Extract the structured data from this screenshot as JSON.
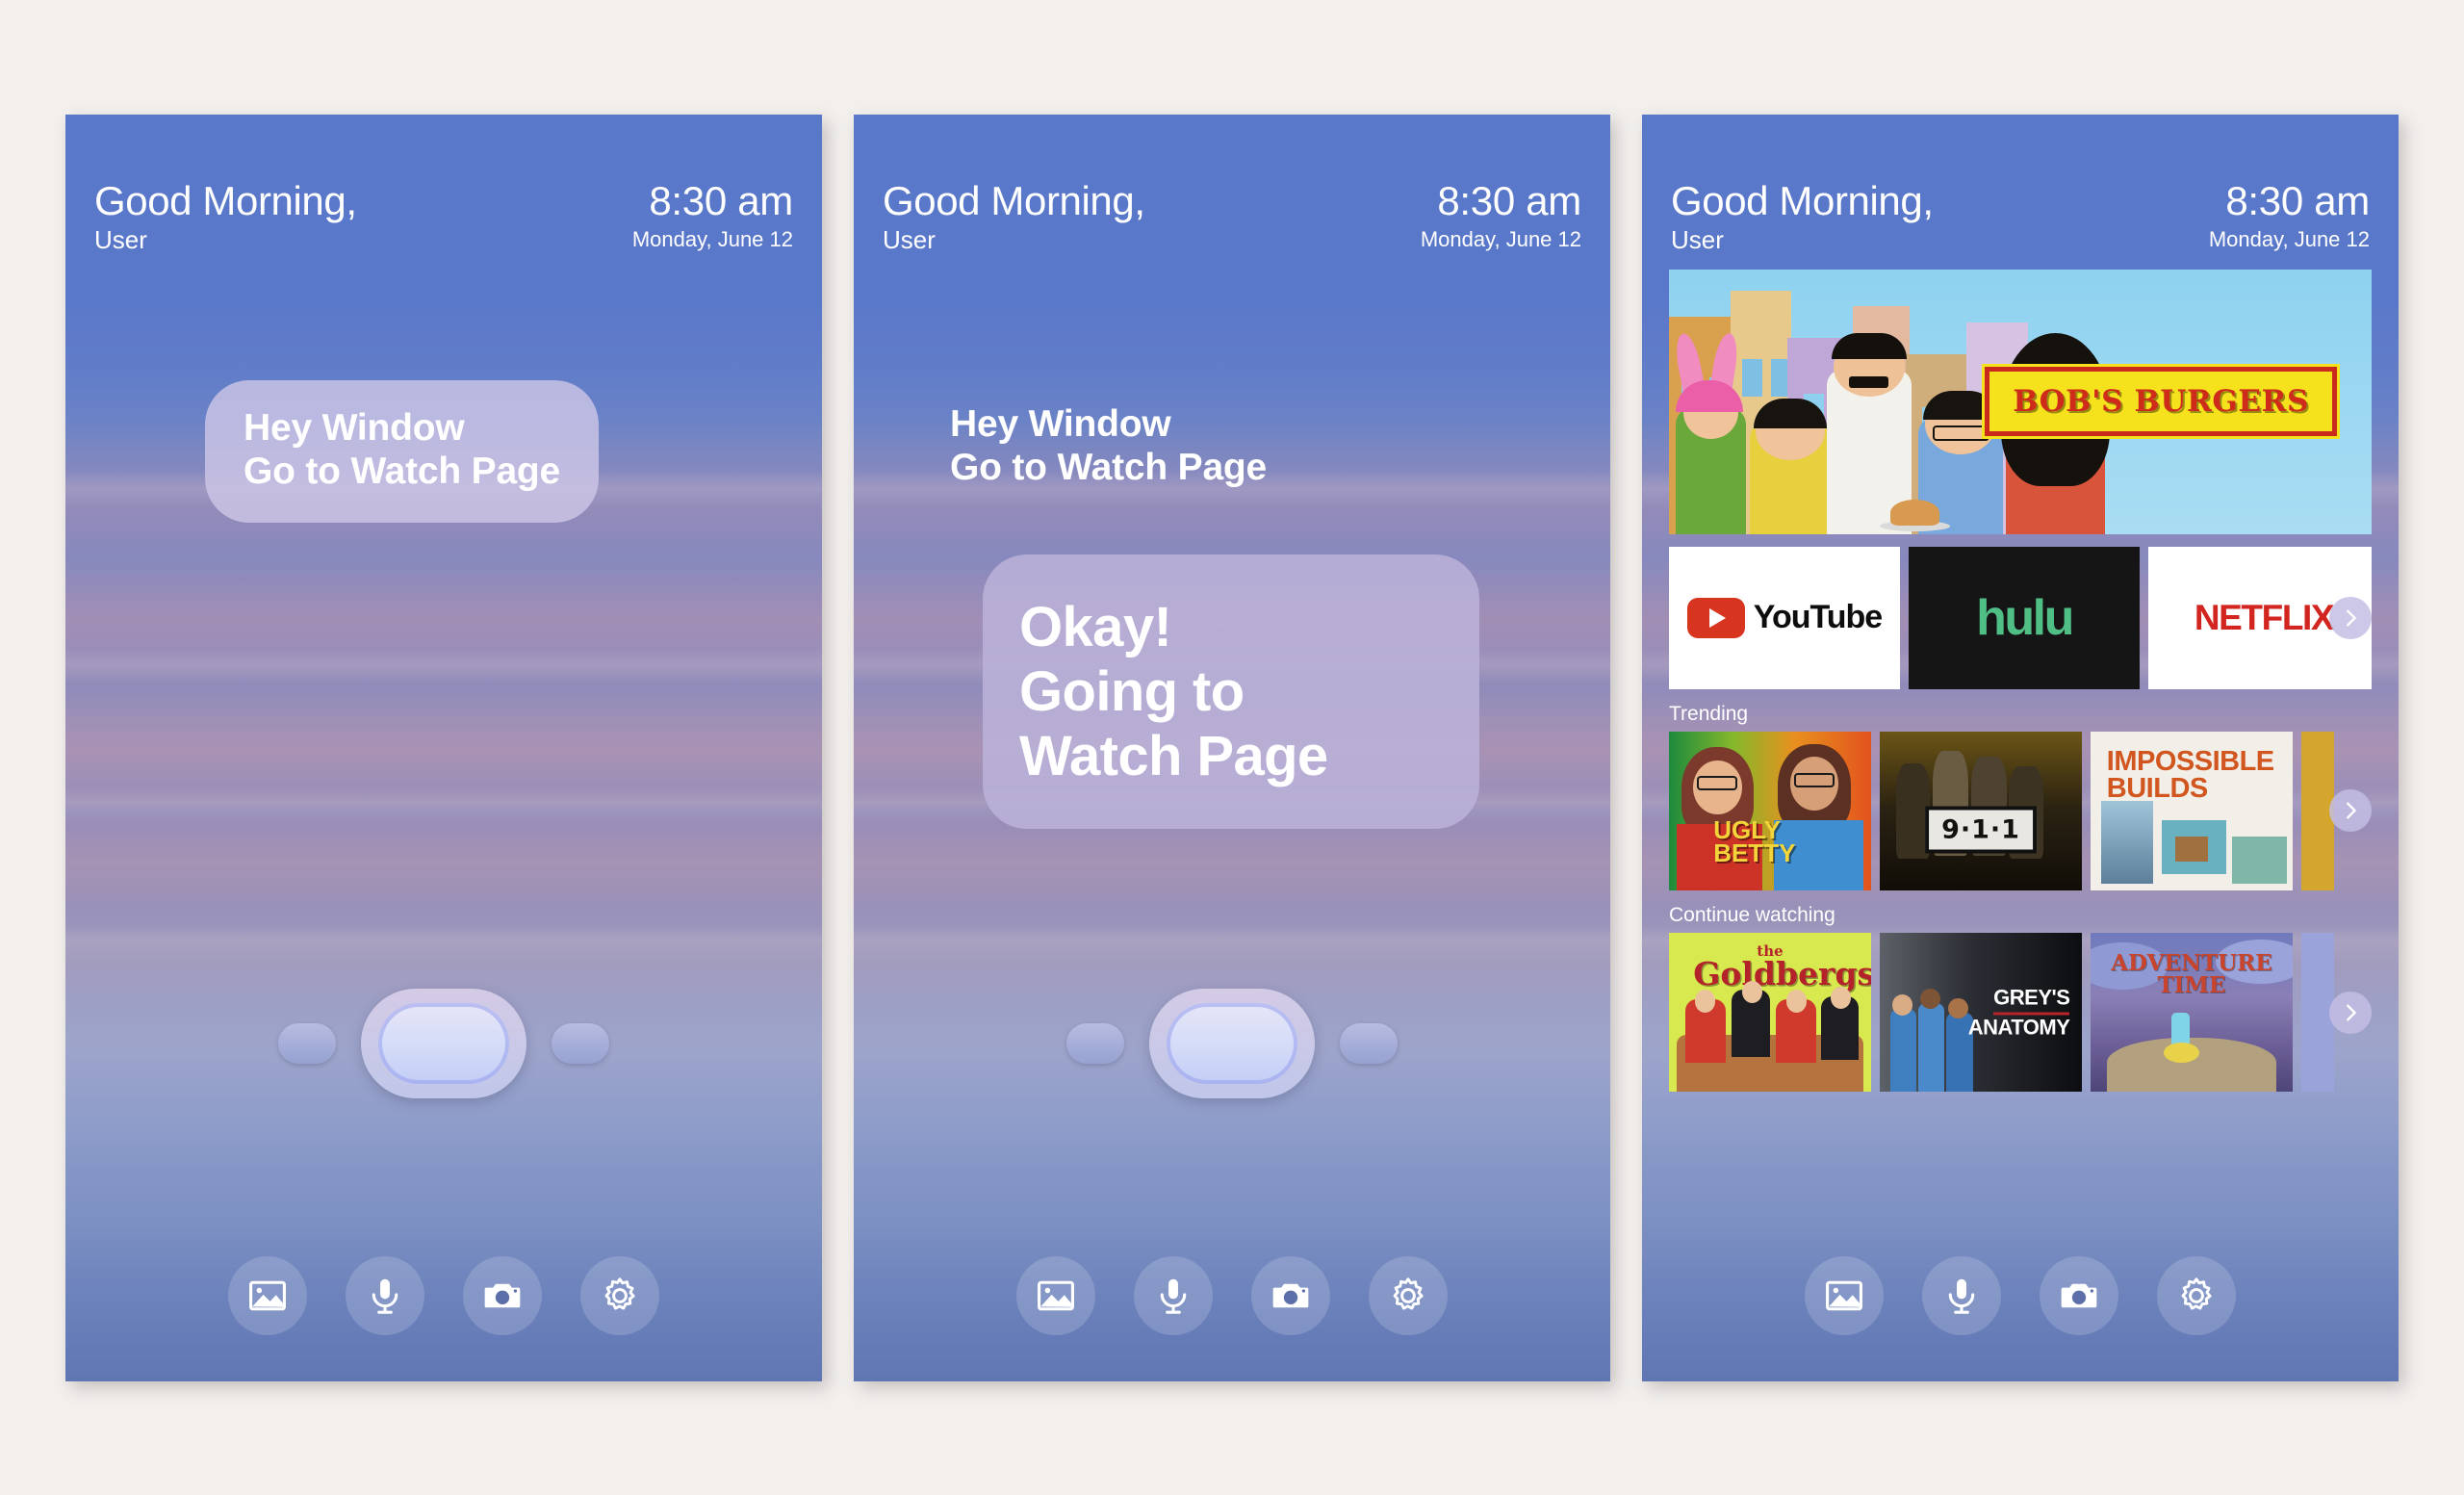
{
  "background_color": "#f2efed",
  "accent_color": "#5a78c9",
  "bubble_color": "#cec7e7",
  "panels": [
    {
      "id": "panel-listening",
      "header": {
        "greeting": "Good Morning,",
        "user": "User",
        "time": "8:30 am",
        "date": "Monday, June 12"
      },
      "user_utterance": {
        "line1": "Hey Window",
        "line2": "Go to Watch Page"
      },
      "style": "bubble"
    },
    {
      "id": "panel-responding",
      "header": {
        "greeting": "Good Morning,",
        "user": "User",
        "time": "8:30 am",
        "date": "Monday, June 12"
      },
      "user_utterance": {
        "line1": "Hey Window",
        "line2": "Go to Watch Page"
      },
      "assistant_reply": {
        "line1": "Okay!",
        "line2": "Going to",
        "line3": "Watch Page"
      },
      "style": "plain"
    },
    {
      "id": "panel-watch",
      "header": {
        "greeting": "Good Morning,",
        "user": "User",
        "time": "8:30 am",
        "date": "Monday, June 12"
      },
      "hero": {
        "title": "BOB'S BURGERS"
      },
      "rows": [
        {
          "label": "",
          "kind": "services",
          "tiles": [
            {
              "name": "YouTube",
              "text": "YouTube"
            },
            {
              "name": "hulu",
              "text": "hulu"
            },
            {
              "name": "NETFLIX",
              "text": "NETFLIX"
            },
            {
              "name": "more",
              "text": ""
            }
          ]
        },
        {
          "label": "Trending",
          "kind": "posters",
          "tiles": [
            {
              "name": "Ugly Betty",
              "line1": "UGLY",
              "line2": "BETTY"
            },
            {
              "name": "9-1-1",
              "text": "9·1·1"
            },
            {
              "name": "Impossible Builds",
              "line1": "IMPOSSIBLE",
              "line2": "BUILDS"
            },
            {
              "name": "more",
              "text": ""
            }
          ]
        },
        {
          "label": "Continue watching",
          "kind": "posters",
          "tiles": [
            {
              "name": "The Goldbergs",
              "line1": "the",
              "line2": "Goldbergs"
            },
            {
              "name": "Grey's Anatomy",
              "line1": "GREY'S",
              "line2": "ANATOMY"
            },
            {
              "name": "Adventure Time",
              "line1": "ADVENTURE",
              "line2": "TIME"
            },
            {
              "name": "more",
              "text": ""
            }
          ]
        }
      ]
    }
  ],
  "toolbar": {
    "gallery_label": "Gallery",
    "mic_label": "Microphone",
    "camera_label": "Camera",
    "settings_label": "Settings"
  },
  "scroll_arrow_label": "›"
}
